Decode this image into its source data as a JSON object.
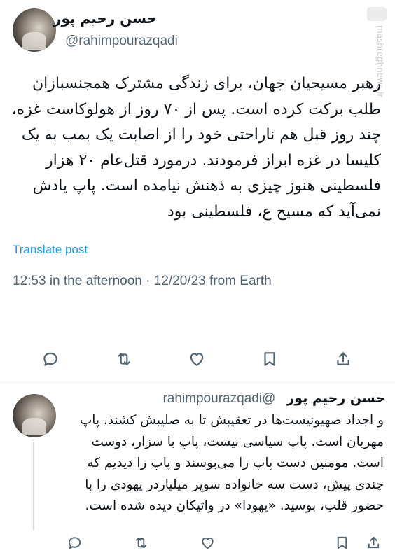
{
  "post": {
    "author_name": "حسن رحیم پور",
    "author_handle": "@rahimpourazqadi",
    "text": "رهبر مسیحیان جهان، برای زندگی مشترک همجنسبازان طلب برکت کرده است. پس از ۷۰ روز از هولوکاست غزه، چند روز قبل هم ناراحتی خود را از اصابت یک بمب به یک کلیسا در غزه ابراز فرمودند. درمورد قتل‌عام ۲۰ هزار فلسطینی هنوز چیزی به ذهنش نیامده است. پاپ یادش نمی‌آید که مسیح ع، فلسطینی بود",
    "translate_label": "Translate post",
    "timestamp": "12:53 in the afternoon · 12/20/23 from Earth"
  },
  "reply": {
    "author_name": "حسن رحیم پور",
    "author_handle": "@rahimpourazqadi",
    "text": "و اجداد صهیونیست‌ها در تعقیبش تا به صلیبش کشند. پاپ مهربان است. پاپ سیاسی نیست، پاپ با سزار، دوست است. مومنین دست پاپ را می‌بوسند و پاپ را دیدیم که چندی پیش، دست سه خانواده سوپر میلیاردر یهودی را با حضور قلب، بوسید. «یهودا» در واتیکان دیده شده است."
  },
  "watermark": {
    "text": "mashreghnews.ir"
  },
  "icons": {
    "actions": [
      "reply-icon",
      "repost-icon",
      "like-icon",
      "bookmark-icon",
      "share-icon"
    ]
  },
  "colors": {
    "link": "#1d9bf0",
    "secondary_text": "#536471",
    "icon": "#536471"
  }
}
